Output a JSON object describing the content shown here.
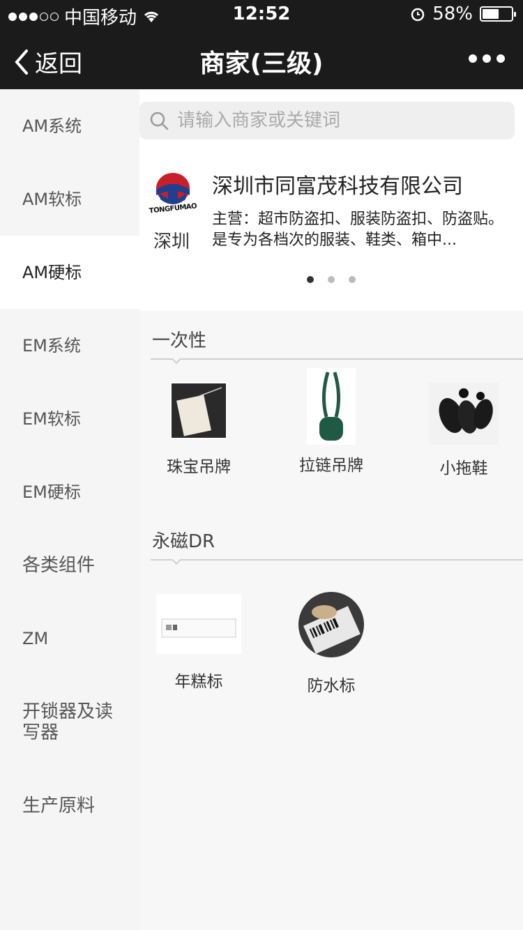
{
  "status": {
    "carrier": "中国移动",
    "time": "12:52",
    "battery": "58%",
    "battery_level": 0.58
  },
  "nav": {
    "back_label": "返回",
    "title": "商家(三级)"
  },
  "sidebar": {
    "items": [
      {
        "label": "AM系统"
      },
      {
        "label": "AM软标"
      },
      {
        "label": "AM硬标"
      },
      {
        "label": "EM系统"
      },
      {
        "label": "EM软标"
      },
      {
        "label": "EM硬标"
      },
      {
        "label": "各类组件"
      },
      {
        "label": "ZM"
      },
      {
        "label": "开锁器及读写器"
      },
      {
        "label": "生产原料"
      }
    ]
  },
  "search": {
    "placeholder": "请输入商家或关键词"
  },
  "merchant": {
    "logo_text": "TONGFUMAO",
    "city": "深圳",
    "name": "深圳市同富茂科技有限公司",
    "desc": "主营：超市防盗扣、服装防盗扣、防盗贴。是专为各档次的服装、鞋类、箱中..."
  },
  "sections": [
    {
      "title": "一次性",
      "items": [
        {
          "label": "珠宝吊牌"
        },
        {
          "label": "拉链吊牌"
        },
        {
          "label": "小拖鞋"
        }
      ]
    },
    {
      "title": "永磁DR",
      "items": [
        {
          "label": "年糕标"
        },
        {
          "label": "防水标"
        }
      ]
    }
  ]
}
